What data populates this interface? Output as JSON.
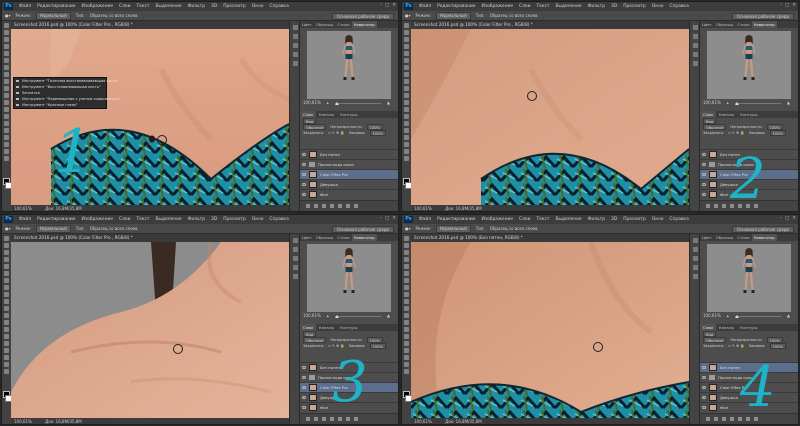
{
  "app": {
    "logo": "Ps",
    "menus": [
      "Файл",
      "Редактирование",
      "Изображение",
      "Слои",
      "Текст",
      "Выделение",
      "Фильтр",
      "3D",
      "Просмотр",
      "Окно",
      "Справка"
    ],
    "options": {
      "mode_label": "Режим:",
      "mode_value": "Нормальный",
      "type_label": "Тип:",
      "sample_all": "Образец со всех слоев",
      "workspace": "Основная рабочая среда"
    }
  },
  "windows": [
    {
      "doc_title": "Screenshot 2016.psd @ 100% (Color Filter Pro , RGB/8) *",
      "zoom": "100,61%",
      "doc_size": "Док: 16,8M/35,8M",
      "step": "1",
      "nav_zoom": "100,61%",
      "layers": [
        {
          "name": "Без пятен",
          "selected": false,
          "type": "layer"
        },
        {
          "name": "Пропаганда кожи",
          "selected": false,
          "type": "group"
        },
        {
          "name": "Color Effex Pro",
          "selected": true,
          "type": "layer"
        },
        {
          "name": "Девушка",
          "selected": false,
          "type": "layer"
        },
        {
          "name": "Фон",
          "selected": false,
          "type": "layer"
        }
      ],
      "context_menu": [
        "Инструмент \"Точечная восстанавливающая кисть\"",
        "Инструмент \"Восстанавливающая кисть\"",
        "Заплатка",
        "Инструмент \"Перемещение с учетом содержимого\"",
        "Инструмент \"Красные глаза\""
      ]
    },
    {
      "doc_title": "Screenshot 2016.psd @ 100% (Color Filter Pro , RGB/8) *",
      "zoom": "100,61%",
      "doc_size": "Док: 16,8M/35,8M",
      "step": "2",
      "nav_zoom": "100,61%",
      "layers": [
        {
          "name": "Без пятен",
          "selected": false,
          "type": "layer"
        },
        {
          "name": "Пропаганда кожи",
          "selected": false,
          "type": "group"
        },
        {
          "name": "Color Effex Pro",
          "selected": true,
          "type": "layer"
        },
        {
          "name": "Девушка",
          "selected": false,
          "type": "layer"
        },
        {
          "name": "Фон",
          "selected": false,
          "type": "layer"
        }
      ]
    },
    {
      "doc_title": "Screenshot 2016.psd @ 100% (Color Filter Pro , RGB/8) *",
      "zoom": "100,61%",
      "doc_size": "Док: 16,8M/35,8M",
      "step": "3",
      "nav_zoom": "100,61%",
      "layers": [
        {
          "name": "Без пятен",
          "selected": false,
          "type": "layer"
        },
        {
          "name": "Пропаганда кожи",
          "selected": false,
          "type": "group"
        },
        {
          "name": "Color Effex Pro",
          "selected": true,
          "type": "layer"
        },
        {
          "name": "Девушка",
          "selected": false,
          "type": "layer"
        },
        {
          "name": "Фон",
          "selected": false,
          "type": "layer"
        }
      ]
    },
    {
      "doc_title": "Screenshot 2016.psd @ 100% (Без пятен, RGB/8) *",
      "zoom": "100,61%",
      "doc_size": "Док: 16,8M/35,8M",
      "step": "4",
      "nav_zoom": "100,61%",
      "layers": [
        {
          "name": "Без пятен",
          "selected": true,
          "type": "layer"
        },
        {
          "name": "Пропаганда кожи",
          "selected": false,
          "type": "group"
        },
        {
          "name": "Color Effex Pro",
          "selected": false,
          "type": "layer"
        },
        {
          "name": "Девушка",
          "selected": false,
          "type": "layer"
        },
        {
          "name": "Фон",
          "selected": false,
          "type": "layer"
        }
      ]
    }
  ],
  "panels": {
    "nav_tabs": [
      "Цвет",
      "Образцы",
      "Стили",
      "Навигатор"
    ],
    "layer_tabs": [
      "Слои",
      "Каналы",
      "Контуры"
    ],
    "kind": "Вид",
    "blend_mode": "Обычные",
    "opacity_label": "Непрозрачность:",
    "opacity_value": "100%",
    "lock_label": "Закрепить:",
    "fill_label": "Заливка:",
    "fill_value": "100%"
  },
  "colors": {
    "accent_step": "#1fb3c7",
    "selected_layer": "#5b6e8e",
    "ps_blue": "#31a8ff"
  }
}
